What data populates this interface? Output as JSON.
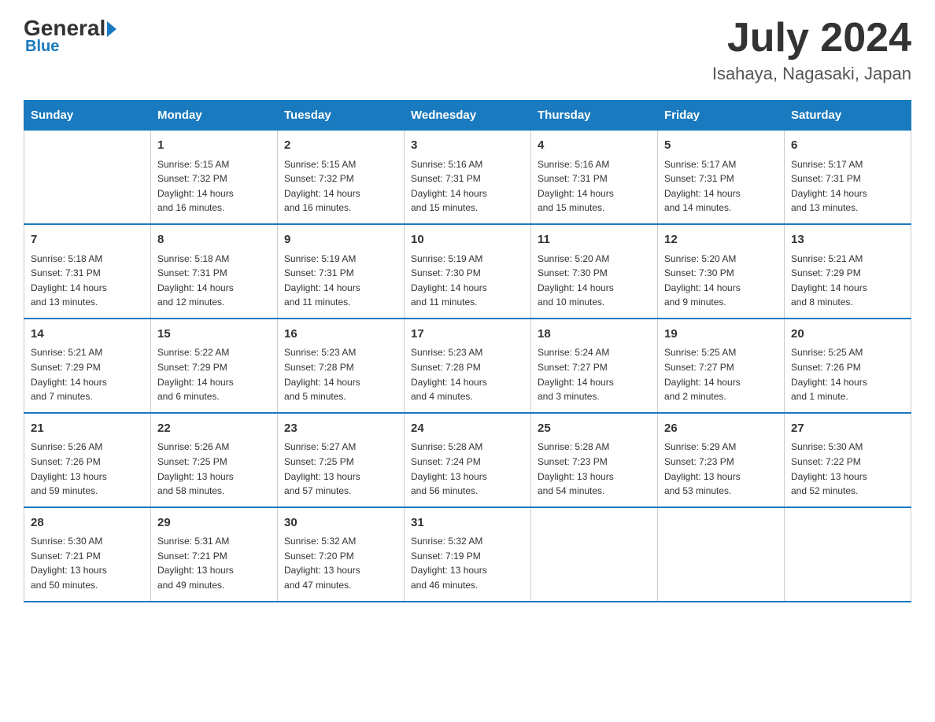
{
  "header": {
    "logo_general": "General",
    "logo_blue": "Blue",
    "month_title": "July 2024",
    "location": "Isahaya, Nagasaki, Japan"
  },
  "days_of_week": [
    "Sunday",
    "Monday",
    "Tuesday",
    "Wednesday",
    "Thursday",
    "Friday",
    "Saturday"
  ],
  "weeks": [
    [
      {
        "day": "",
        "info": ""
      },
      {
        "day": "1",
        "info": "Sunrise: 5:15 AM\nSunset: 7:32 PM\nDaylight: 14 hours\nand 16 minutes."
      },
      {
        "day": "2",
        "info": "Sunrise: 5:15 AM\nSunset: 7:32 PM\nDaylight: 14 hours\nand 16 minutes."
      },
      {
        "day": "3",
        "info": "Sunrise: 5:16 AM\nSunset: 7:31 PM\nDaylight: 14 hours\nand 15 minutes."
      },
      {
        "day": "4",
        "info": "Sunrise: 5:16 AM\nSunset: 7:31 PM\nDaylight: 14 hours\nand 15 minutes."
      },
      {
        "day": "5",
        "info": "Sunrise: 5:17 AM\nSunset: 7:31 PM\nDaylight: 14 hours\nand 14 minutes."
      },
      {
        "day": "6",
        "info": "Sunrise: 5:17 AM\nSunset: 7:31 PM\nDaylight: 14 hours\nand 13 minutes."
      }
    ],
    [
      {
        "day": "7",
        "info": "Sunrise: 5:18 AM\nSunset: 7:31 PM\nDaylight: 14 hours\nand 13 minutes."
      },
      {
        "day": "8",
        "info": "Sunrise: 5:18 AM\nSunset: 7:31 PM\nDaylight: 14 hours\nand 12 minutes."
      },
      {
        "day": "9",
        "info": "Sunrise: 5:19 AM\nSunset: 7:31 PM\nDaylight: 14 hours\nand 11 minutes."
      },
      {
        "day": "10",
        "info": "Sunrise: 5:19 AM\nSunset: 7:30 PM\nDaylight: 14 hours\nand 11 minutes."
      },
      {
        "day": "11",
        "info": "Sunrise: 5:20 AM\nSunset: 7:30 PM\nDaylight: 14 hours\nand 10 minutes."
      },
      {
        "day": "12",
        "info": "Sunrise: 5:20 AM\nSunset: 7:30 PM\nDaylight: 14 hours\nand 9 minutes."
      },
      {
        "day": "13",
        "info": "Sunrise: 5:21 AM\nSunset: 7:29 PM\nDaylight: 14 hours\nand 8 minutes."
      }
    ],
    [
      {
        "day": "14",
        "info": "Sunrise: 5:21 AM\nSunset: 7:29 PM\nDaylight: 14 hours\nand 7 minutes."
      },
      {
        "day": "15",
        "info": "Sunrise: 5:22 AM\nSunset: 7:29 PM\nDaylight: 14 hours\nand 6 minutes."
      },
      {
        "day": "16",
        "info": "Sunrise: 5:23 AM\nSunset: 7:28 PM\nDaylight: 14 hours\nand 5 minutes."
      },
      {
        "day": "17",
        "info": "Sunrise: 5:23 AM\nSunset: 7:28 PM\nDaylight: 14 hours\nand 4 minutes."
      },
      {
        "day": "18",
        "info": "Sunrise: 5:24 AM\nSunset: 7:27 PM\nDaylight: 14 hours\nand 3 minutes."
      },
      {
        "day": "19",
        "info": "Sunrise: 5:25 AM\nSunset: 7:27 PM\nDaylight: 14 hours\nand 2 minutes."
      },
      {
        "day": "20",
        "info": "Sunrise: 5:25 AM\nSunset: 7:26 PM\nDaylight: 14 hours\nand 1 minute."
      }
    ],
    [
      {
        "day": "21",
        "info": "Sunrise: 5:26 AM\nSunset: 7:26 PM\nDaylight: 13 hours\nand 59 minutes."
      },
      {
        "day": "22",
        "info": "Sunrise: 5:26 AM\nSunset: 7:25 PM\nDaylight: 13 hours\nand 58 minutes."
      },
      {
        "day": "23",
        "info": "Sunrise: 5:27 AM\nSunset: 7:25 PM\nDaylight: 13 hours\nand 57 minutes."
      },
      {
        "day": "24",
        "info": "Sunrise: 5:28 AM\nSunset: 7:24 PM\nDaylight: 13 hours\nand 56 minutes."
      },
      {
        "day": "25",
        "info": "Sunrise: 5:28 AM\nSunset: 7:23 PM\nDaylight: 13 hours\nand 54 minutes."
      },
      {
        "day": "26",
        "info": "Sunrise: 5:29 AM\nSunset: 7:23 PM\nDaylight: 13 hours\nand 53 minutes."
      },
      {
        "day": "27",
        "info": "Sunrise: 5:30 AM\nSunset: 7:22 PM\nDaylight: 13 hours\nand 52 minutes."
      }
    ],
    [
      {
        "day": "28",
        "info": "Sunrise: 5:30 AM\nSunset: 7:21 PM\nDaylight: 13 hours\nand 50 minutes."
      },
      {
        "day": "29",
        "info": "Sunrise: 5:31 AM\nSunset: 7:21 PM\nDaylight: 13 hours\nand 49 minutes."
      },
      {
        "day": "30",
        "info": "Sunrise: 5:32 AM\nSunset: 7:20 PM\nDaylight: 13 hours\nand 47 minutes."
      },
      {
        "day": "31",
        "info": "Sunrise: 5:32 AM\nSunset: 7:19 PM\nDaylight: 13 hours\nand 46 minutes."
      },
      {
        "day": "",
        "info": ""
      },
      {
        "day": "",
        "info": ""
      },
      {
        "day": "",
        "info": ""
      }
    ]
  ]
}
